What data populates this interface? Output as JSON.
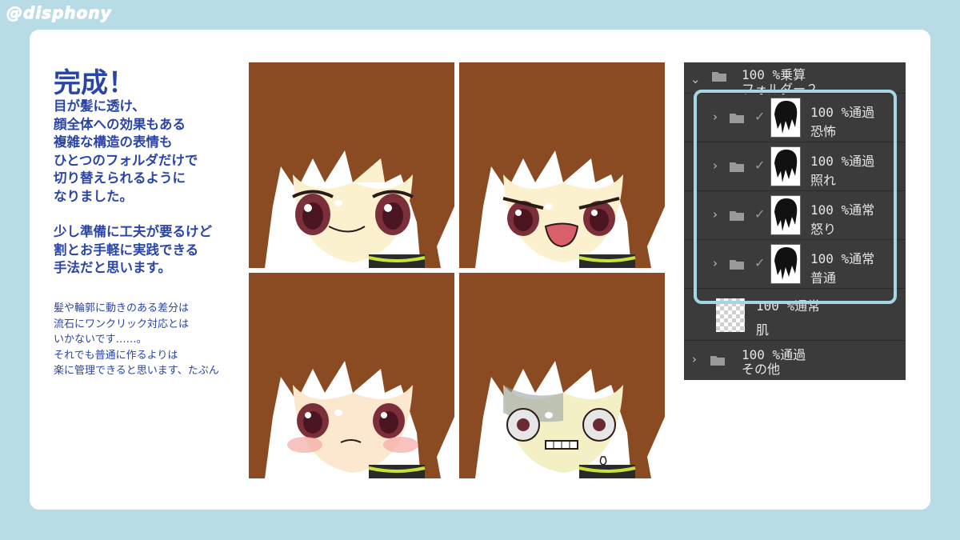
{
  "handle": "@disphony",
  "text": {
    "title": "完成！",
    "main_lines": [
      "目が髪に透け、",
      "顔全体への効果もある",
      "複雑な構造の表情も",
      "ひとつのフォルダだけで",
      "切り替えられるように",
      "なりました。",
      "少し準備に工夫が要るけど",
      "割とお手軽に実践できる",
      "手法だと思います。"
    ],
    "note_lines": [
      "髪や輪郭に動きのある差分は",
      "流石にワンクリック対応とは",
      "いかないです……。",
      "それでも普通に作るよりは",
      "楽に管理できると思います、たぶん"
    ]
  },
  "faces": [
    {
      "expression": "smile"
    },
    {
      "expression": "angry"
    },
    {
      "expression": "embarrassed"
    },
    {
      "expression": "fear"
    }
  ],
  "layers_panel": {
    "top_folder": {
      "mode": "100 %乗算",
      "name": "フォルダー２"
    },
    "expression_folders": [
      {
        "mode": "100 %通過",
        "name": "恐怖"
      },
      {
        "mode": "100 %通過",
        "name": "照れ"
      },
      {
        "mode": "100 %通常",
        "name": "怒り"
      },
      {
        "mode": "100 %通常",
        "name": "普通"
      }
    ],
    "skin_layer": {
      "mode": "100 %通常",
      "name": "肌"
    },
    "other_folder": {
      "mode": "100 %通過",
      "name": "その他"
    }
  },
  "colors": {
    "background": "#b8dce6",
    "text_blue": "#2a45a8",
    "panel_bg": "#3b3b3b",
    "highlight": "#a4d6e4",
    "hair": "#8a4a22"
  }
}
